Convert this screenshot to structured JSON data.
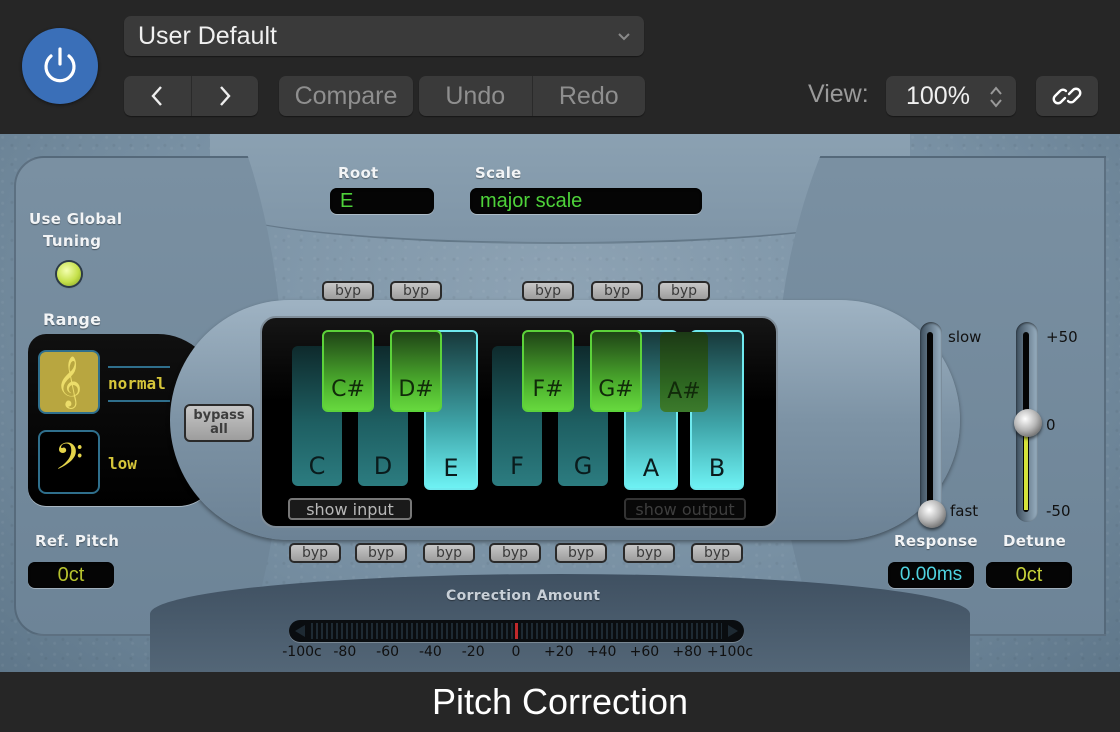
{
  "header": {
    "preset": "User Default",
    "nav_prev": "‹",
    "nav_next": "›",
    "compare": "Compare",
    "undo": "Undo",
    "redo": "Redo",
    "view_label": "View:",
    "view_zoom": "100%",
    "power_color": "#3a6fb8",
    "power_on": true
  },
  "plugin": {
    "root_label": "Root",
    "root_value": "E",
    "scale_label": "Scale",
    "scale_value": "major scale",
    "global_tuning_label_1": "Use Global",
    "global_tuning_label_2": "Tuning",
    "global_tuning_on": true,
    "range_label": "Range",
    "range_options": [
      {
        "label": "normal",
        "icon": "treble-clef-icon",
        "selected": true
      },
      {
        "label": "low",
        "icon": "bass-clef-icon",
        "selected": false
      }
    ],
    "ref_pitch_label": "Ref. Pitch",
    "ref_pitch_value": "0ct",
    "bypass_all": "bypass\nall",
    "byp_label": "byp",
    "white_keys": [
      {
        "note": "C",
        "active": false
      },
      {
        "note": "D",
        "active": false
      },
      {
        "note": "E",
        "active": true
      },
      {
        "note": "F",
        "active": false
      },
      {
        "note": "G",
        "active": false
      },
      {
        "note": "A",
        "active": true
      },
      {
        "note": "B",
        "active": true
      }
    ],
    "black_keys": [
      {
        "note": "C#",
        "active": true
      },
      {
        "note": "D#",
        "active": true
      },
      {
        "note": "F#",
        "active": true
      },
      {
        "note": "G#",
        "active": true
      },
      {
        "note": "A#",
        "active": false
      }
    ],
    "show_input": "show input",
    "show_output": "show output",
    "response_label": "Response",
    "response_value": "0.00ms",
    "response_slow": "slow",
    "response_fast": "fast",
    "response_position": 0.0,
    "detune_label": "Detune",
    "detune_value": "0ct",
    "detune_max": "+50",
    "detune_zero": "0",
    "detune_min": "-50",
    "detune_position": 0,
    "correction_label": "Correction Amount",
    "correction_value": 0,
    "correction_ticks": [
      "-100c",
      "-80",
      "-60",
      "-40",
      "-20",
      "0",
      "+20",
      "+40",
      "+60",
      "+80",
      "+100c"
    ],
    "colors": {
      "lcd_green": "#4ed23a",
      "lcd_yellow": "#c6d23a",
      "lcd_cyan": "#4fd3e0",
      "range_yellow": "#d6c63a"
    }
  },
  "footer": {
    "title": "Pitch Correction"
  }
}
